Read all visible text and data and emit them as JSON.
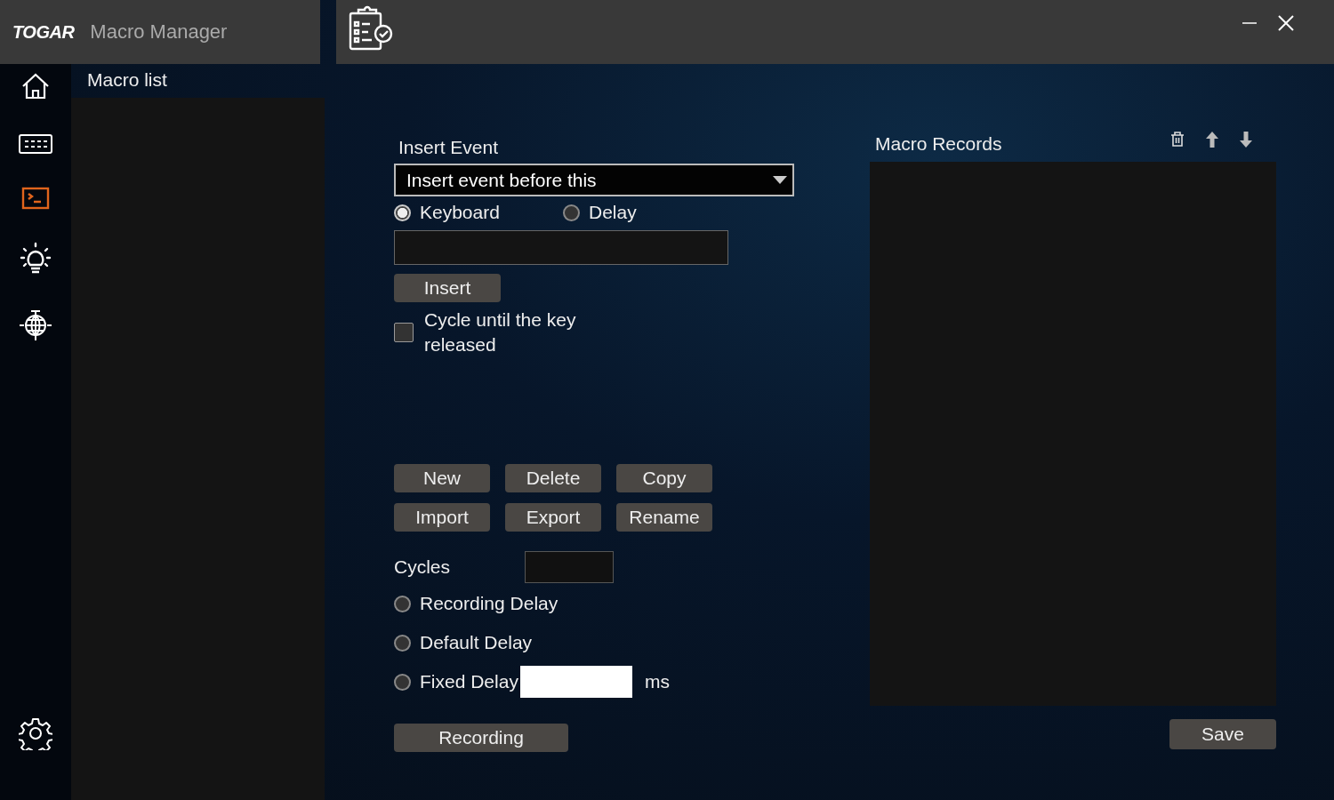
{
  "window": {
    "brand": "TOGAR",
    "title": "Macro Manager"
  },
  "sidebar": {
    "items": [
      {
        "kind": "home",
        "selected": false
      },
      {
        "kind": "keyboard",
        "selected": false
      },
      {
        "kind": "macro",
        "selected": true
      },
      {
        "kind": "light",
        "selected": false
      },
      {
        "kind": "network",
        "selected": false
      }
    ],
    "footer": {
      "kind": "settings"
    }
  },
  "macro_list": {
    "title": "Macro list"
  },
  "insert_event": {
    "label": "Insert Event",
    "dropdown": "Insert event before this",
    "types": [
      {
        "label": "Keyboard",
        "selected": true
      },
      {
        "label": "Delay",
        "selected": false
      }
    ],
    "insert_button": "Insert",
    "cycle": {
      "label": "Cycle until the key released",
      "checked": false
    }
  },
  "actions": [
    "New",
    "Delete",
    "Copy",
    "Import",
    "Export",
    "Rename"
  ],
  "cycles": {
    "label": "Cycles"
  },
  "delay_modes": [
    {
      "label": "Recording Delay",
      "selected": false
    },
    {
      "label": "Default Delay",
      "selected": false
    },
    {
      "label": "Fixed Delay",
      "selected": false,
      "unit": "ms"
    }
  ],
  "recording_button": "Recording",
  "macro_records": {
    "title": "Macro Records"
  },
  "save_button": "Save"
}
